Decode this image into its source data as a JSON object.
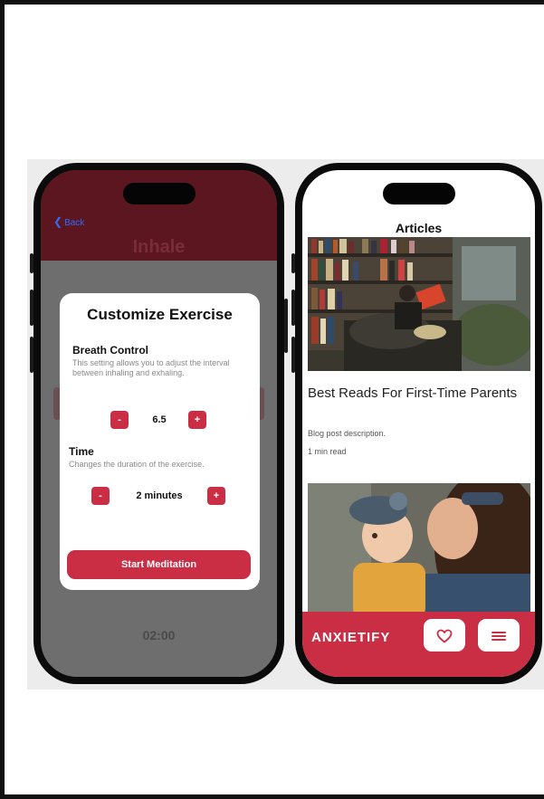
{
  "left_phone": {
    "back_label": "Back",
    "back_icon": "chevron-left-icon",
    "phase_label": "Inhale",
    "timer": "02:00",
    "modal": {
      "title": "Customize Exercise",
      "breath_control": {
        "title": "Breath Control",
        "description": "This setting allows you to adjust the interval between inhaling and exhaling.",
        "value": "6.5",
        "decrement_label": "-",
        "increment_label": "+"
      },
      "time": {
        "title": "Time",
        "description": "Changes the duration of the exercise.",
        "value": "2 minutes",
        "decrement_label": "-",
        "increment_label": "+"
      },
      "start_label": "Start Meditation"
    }
  },
  "right_phone": {
    "header_title": "Articles",
    "article": {
      "title": "Best Reads For First-Time Parents",
      "description": "Blog post description.",
      "meta": "1 min read"
    },
    "nav": {
      "brand": "ANXIETIFY",
      "buttons": [
        {
          "icon": "heart-icon"
        },
        {
          "icon": "menu-icon"
        }
      ]
    }
  },
  "colors": {
    "accent": "#c92e45",
    "header_dark": "#5b1620",
    "overlay": "#6e6e6e"
  }
}
